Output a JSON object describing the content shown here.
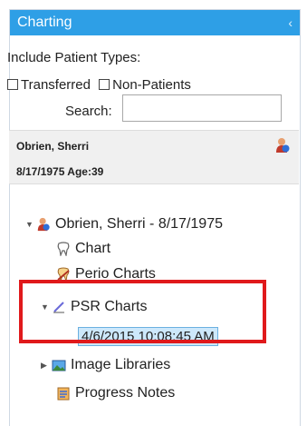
{
  "header": {
    "title": "Charting",
    "collapse_glyph": "‹"
  },
  "filters": {
    "title": "Include Patient Types:",
    "options": [
      {
        "label": "Transferred",
        "checked": false
      },
      {
        "label": "Non-Patients",
        "checked": false
      }
    ]
  },
  "search": {
    "label": "Search:",
    "value": ""
  },
  "patient": {
    "name": "Obrien, Sherri",
    "dob_age": "8/17/1975 Age:39",
    "icon": "person-icon"
  },
  "tree": {
    "root": {
      "label": "Obrien, Sherri - 8/17/1975",
      "expanded": true
    },
    "items": [
      {
        "label": "Chart",
        "icon": "tooth-icon"
      },
      {
        "label": "Perio Charts",
        "icon": "perio-icon"
      },
      {
        "label": "PSR Charts",
        "icon": "pencil-icon",
        "expanded": true
      },
      {
        "label": "4/6/2015 10:08:45 AM",
        "selected": true
      },
      {
        "label": "Image Libraries",
        "icon": "image-icon",
        "expanded": false
      },
      {
        "label": "Progress Notes",
        "icon": "notes-icon"
      }
    ]
  },
  "colors": {
    "header": "#2e9fe6",
    "highlight": "#e0191b",
    "selection": "#cde8fb"
  }
}
